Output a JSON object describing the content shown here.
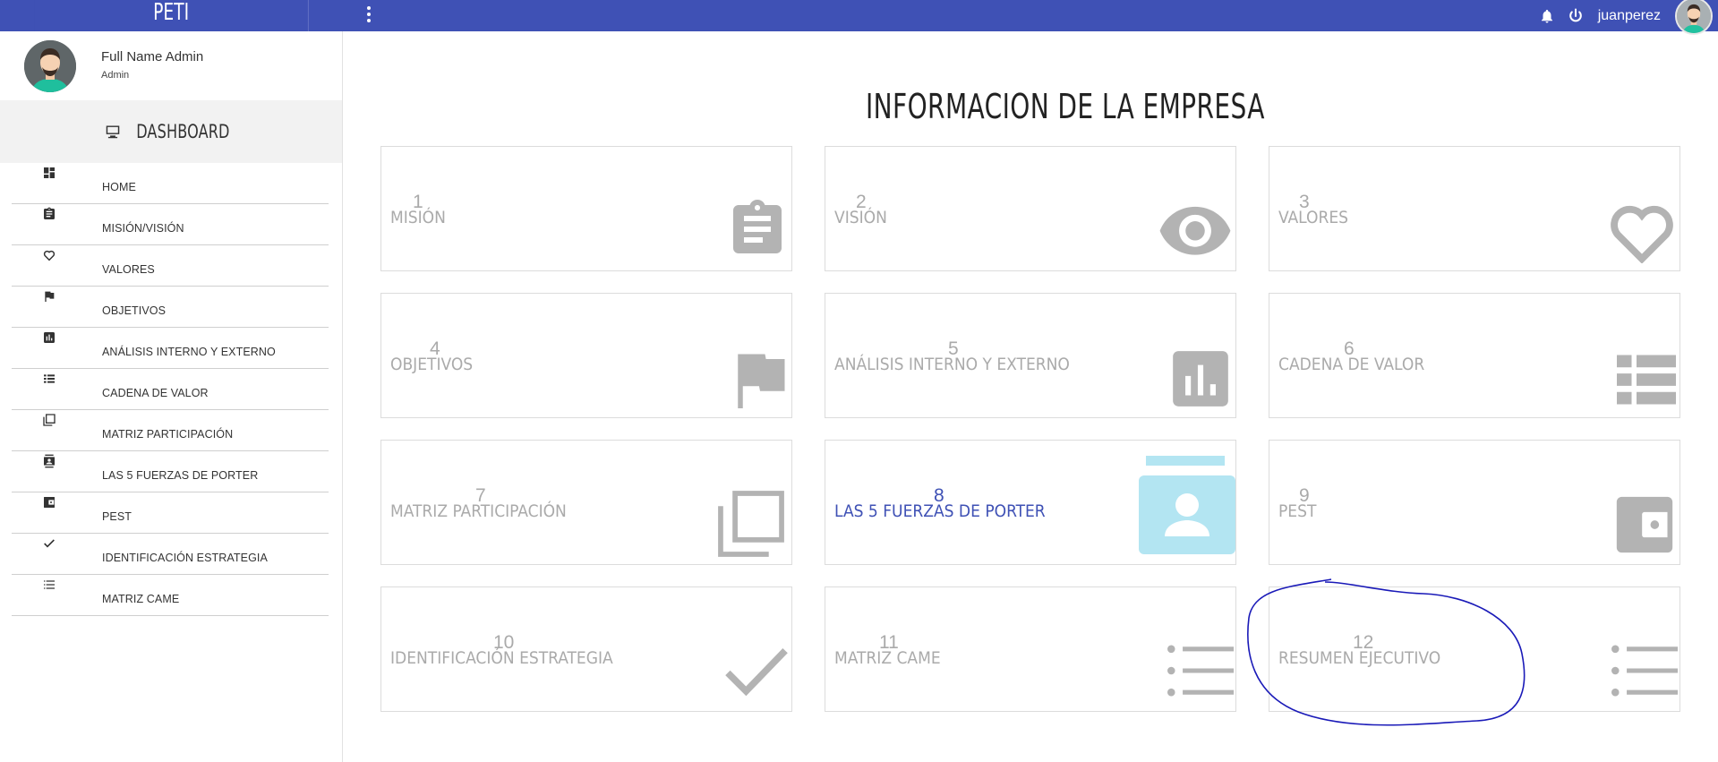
{
  "header": {
    "brand": "PETI",
    "username": "juanperez"
  },
  "sidebar": {
    "profile_name": "Full Name Admin",
    "profile_role": "Admin",
    "dashboard_label": "DASHBOARD",
    "items": [
      {
        "label": "HOME",
        "icon": "dashboard-icon"
      },
      {
        "label": "MISIÓN/VISIÓN",
        "icon": "clipboard-icon"
      },
      {
        "label": "VALORES",
        "icon": "heart-icon"
      },
      {
        "label": "OBJETIVOS",
        "icon": "flag-icon"
      },
      {
        "label": "ANÁLISIS INTERNO Y EXTERNO",
        "icon": "bar-chart-icon"
      },
      {
        "label": "CADENA DE VALOR",
        "icon": "list-icon"
      },
      {
        "label": "MATRIZ PARTICIPACIÓN",
        "icon": "copy-icon"
      },
      {
        "label": "LAS 5 FUERZAS DE PORTER",
        "icon": "contact-card-icon"
      },
      {
        "label": "PEST",
        "icon": "wallet-icon"
      },
      {
        "label": "IDENTIFICACIÓN ESTRATEGIA",
        "icon": "check-icon"
      },
      {
        "label": "MATRIZ CAME",
        "icon": "bullet-list-icon"
      }
    ]
  },
  "main": {
    "title": "INFORMACION DE LA EMPRESA",
    "cards": [
      {
        "number": "1",
        "label": "MISIÓN",
        "icon": "clipboard-icon"
      },
      {
        "number": "2",
        "label": "VISIÓN",
        "icon": "eye-icon"
      },
      {
        "number": "3",
        "label": "VALORES",
        "icon": "heart-icon"
      },
      {
        "number": "4",
        "label": "OBJETIVOS",
        "icon": "flag-icon"
      },
      {
        "number": "5",
        "label": "ANÁLISIS INTERNO Y EXTERNO",
        "icon": "bar-chart-icon"
      },
      {
        "number": "6",
        "label": "CADENA DE VALOR",
        "icon": "list-icon"
      },
      {
        "number": "7",
        "label": "MATRIZ PARTICIPACIÓN",
        "icon": "copy-icon"
      },
      {
        "number": "8",
        "label": "LAS 5 FUERZAS DE PORTER",
        "icon": "contact-card-icon",
        "active": true
      },
      {
        "number": "9",
        "label": "PEST",
        "icon": "wallet-icon"
      },
      {
        "number": "10",
        "label": "IDENTIFICACIÓN ESTRATEGIA",
        "icon": "check-icon"
      },
      {
        "number": "11",
        "label": "MATRIZ CAME",
        "icon": "bullet-list-icon"
      },
      {
        "number": "12",
        "label": "RESUMEN EJECUTIVO",
        "icon": "bullet-list-icon"
      }
    ]
  },
  "colors": {
    "primary": "#3f51b5",
    "card_text": "#aaaaaa",
    "card_icon": "#b3b3b3",
    "active_icon": "#b3e5f2",
    "annotation": "#1a1ab8"
  }
}
